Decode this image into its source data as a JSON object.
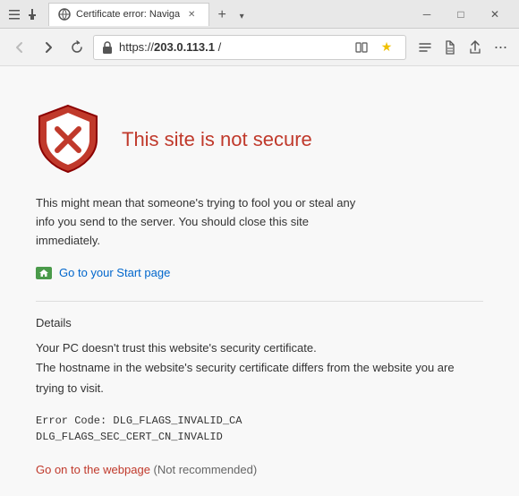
{
  "window": {
    "title": "Certificate error: Naviga",
    "tab_title": "Certificate error: Naviga"
  },
  "titlebar": {
    "back_label": "←",
    "forward_label": "→",
    "refresh_label": "↻",
    "settings_label": "☰",
    "new_tab_label": "+",
    "tab_dropdown_label": "▾",
    "minimize_label": "─",
    "maximize_label": "□",
    "close_label": "✕"
  },
  "addressbar": {
    "url_prefix": "https://",
    "url_domain": "203.0.113.1",
    "url_suffix": " /",
    "lock_icon": "🔒",
    "reader_icon": "📖",
    "star_icon": "★",
    "favorites_icon": "♡",
    "notes_icon": "✏",
    "share_icon": "⤴",
    "more_icon": "•••"
  },
  "error": {
    "title": "This site is not secure",
    "description": "This might mean that someone's trying to fool you or steal any info you send to the server. You should close this site immediately.",
    "start_page_label": "Go to your Start page",
    "details_heading": "Details",
    "detail_line1": "Your PC doesn't trust this website's security certificate.",
    "detail_line2": "The hostname in the website's security certificate differs from the website you are trying to visit.",
    "error_code_line1": "Error Code:  DLG_FLAGS_INVALID_CA",
    "error_code_line2": "DLG_FLAGS_SEC_CERT_CN_INVALID",
    "go_anyway_link": "Go on to the webpage",
    "not_recommended": " (Not recommended)"
  }
}
